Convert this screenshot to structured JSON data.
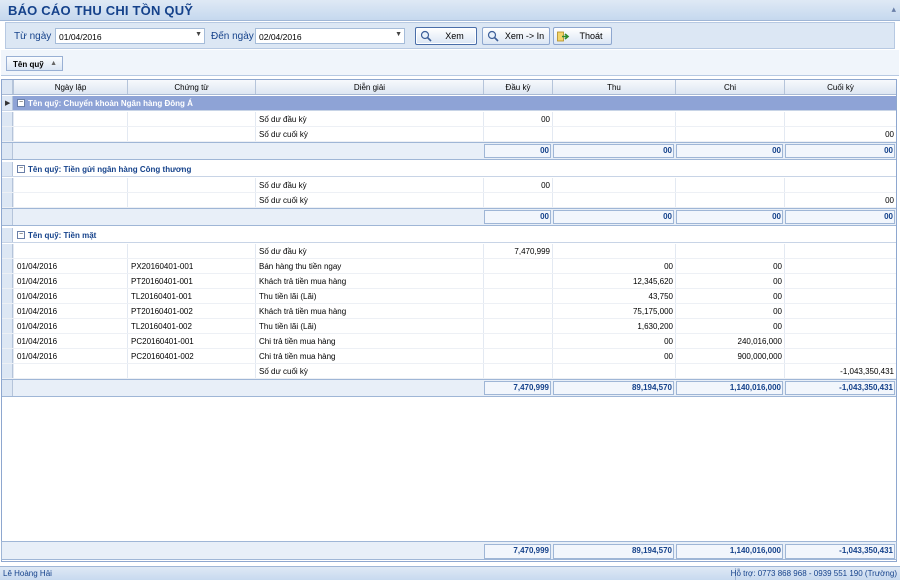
{
  "title": "BÁO CÁO THU CHI TỒN QUỸ",
  "filters": {
    "from_label": "Từ ngày",
    "from_value": "01/04/2016",
    "to_label": "Đến ngày",
    "to_value": "02/04/2016"
  },
  "buttons": {
    "view": "Xem",
    "view_print": "Xem -> In",
    "exit": "Thoát"
  },
  "group_panel": {
    "chip_label": "Tên quỹ"
  },
  "columns": [
    "Ngày lập",
    "Chứng từ",
    "Diễn giải",
    "Đầu kỳ",
    "Thu",
    "Chi",
    "Cuối kỳ"
  ],
  "groups": [
    {
      "title": "Tên quỹ: Chuyển khoản Ngân hàng Đông Á",
      "rows": [
        {
          "date": "",
          "doc": "",
          "desc": "Số dư đầu kỳ",
          "open": "00",
          "in": "",
          "out": "",
          "close": ""
        },
        {
          "date": "",
          "doc": "",
          "desc": "Số dư cuối kỳ",
          "open": "",
          "in": "",
          "out": "",
          "close": "00"
        }
      ],
      "totals": {
        "open": "00",
        "in": "00",
        "out": "00",
        "close": "00"
      }
    },
    {
      "title": "Tên quỹ: Tiền gửi ngân hàng Công thương",
      "rows": [
        {
          "date": "",
          "doc": "",
          "desc": "Số dư đầu kỳ",
          "open": "00",
          "in": "",
          "out": "",
          "close": ""
        },
        {
          "date": "",
          "doc": "",
          "desc": "Số dư cuối kỳ",
          "open": "",
          "in": "",
          "out": "",
          "close": "00"
        }
      ],
      "totals": {
        "open": "00",
        "in": "00",
        "out": "00",
        "close": "00"
      }
    },
    {
      "title": "Tên quỹ: Tiền mặt",
      "rows": [
        {
          "date": "",
          "doc": "",
          "desc": "Số dư đầu kỳ",
          "open": "7,470,999",
          "in": "",
          "out": "",
          "close": ""
        },
        {
          "date": "01/04/2016",
          "doc": "PX20160401-001",
          "desc": "Bán hàng thu tiền ngay",
          "open": "",
          "in": "00",
          "out": "00",
          "close": ""
        },
        {
          "date": "01/04/2016",
          "doc": "PT20160401-001",
          "desc": "Khách trả tiền mua hàng",
          "open": "",
          "in": "12,345,620",
          "out": "00",
          "close": ""
        },
        {
          "date": "01/04/2016",
          "doc": "TL20160401-001",
          "desc": "Thu tiền lãi (Lãi)",
          "open": "",
          "in": "43,750",
          "out": "00",
          "close": ""
        },
        {
          "date": "01/04/2016",
          "doc": "PT20160401-002",
          "desc": "Khách trả tiền mua hàng",
          "open": "",
          "in": "75,175,000",
          "out": "00",
          "close": ""
        },
        {
          "date": "01/04/2016",
          "doc": "TL20160401-002",
          "desc": "Thu tiền lãi (Lãi)",
          "open": "",
          "in": "1,630,200",
          "out": "00",
          "close": ""
        },
        {
          "date": "01/04/2016",
          "doc": "PC20160401-001",
          "desc": "Chi trả tiền mua hàng",
          "open": "",
          "in": "00",
          "out": "240,016,000",
          "close": ""
        },
        {
          "date": "01/04/2016",
          "doc": "PC20160401-002",
          "desc": "Chi trả tiền mua hàng",
          "open": "",
          "in": "00",
          "out": "900,000,000",
          "close": ""
        },
        {
          "date": "",
          "doc": "",
          "desc": "Số dư cuối kỳ",
          "open": "",
          "in": "",
          "out": "",
          "close": "-1,043,350,431"
        }
      ],
      "totals": {
        "open": "7,470,999",
        "in": "89,194,570",
        "out": "1,140,016,000",
        "close": "-1,043,350,431"
      }
    }
  ],
  "grand_total": {
    "open": "7,470,999",
    "in": "89,194,570",
    "out": "1,140,016,000",
    "close": "-1,043,350,431"
  },
  "status": {
    "user": "Lê Hoàng Hải",
    "support": "Hỗ trợ: 0773 868 968 - 0939 551 190 (Trường)"
  },
  "colors": {
    "accent": "#15428b",
    "selected_group": "#8ea3d6",
    "panel": "#dce7f4"
  },
  "icons": {
    "view": "magnifier-icon",
    "view_print": "magnifier-print-icon",
    "exit": "exit-arrow-icon"
  }
}
